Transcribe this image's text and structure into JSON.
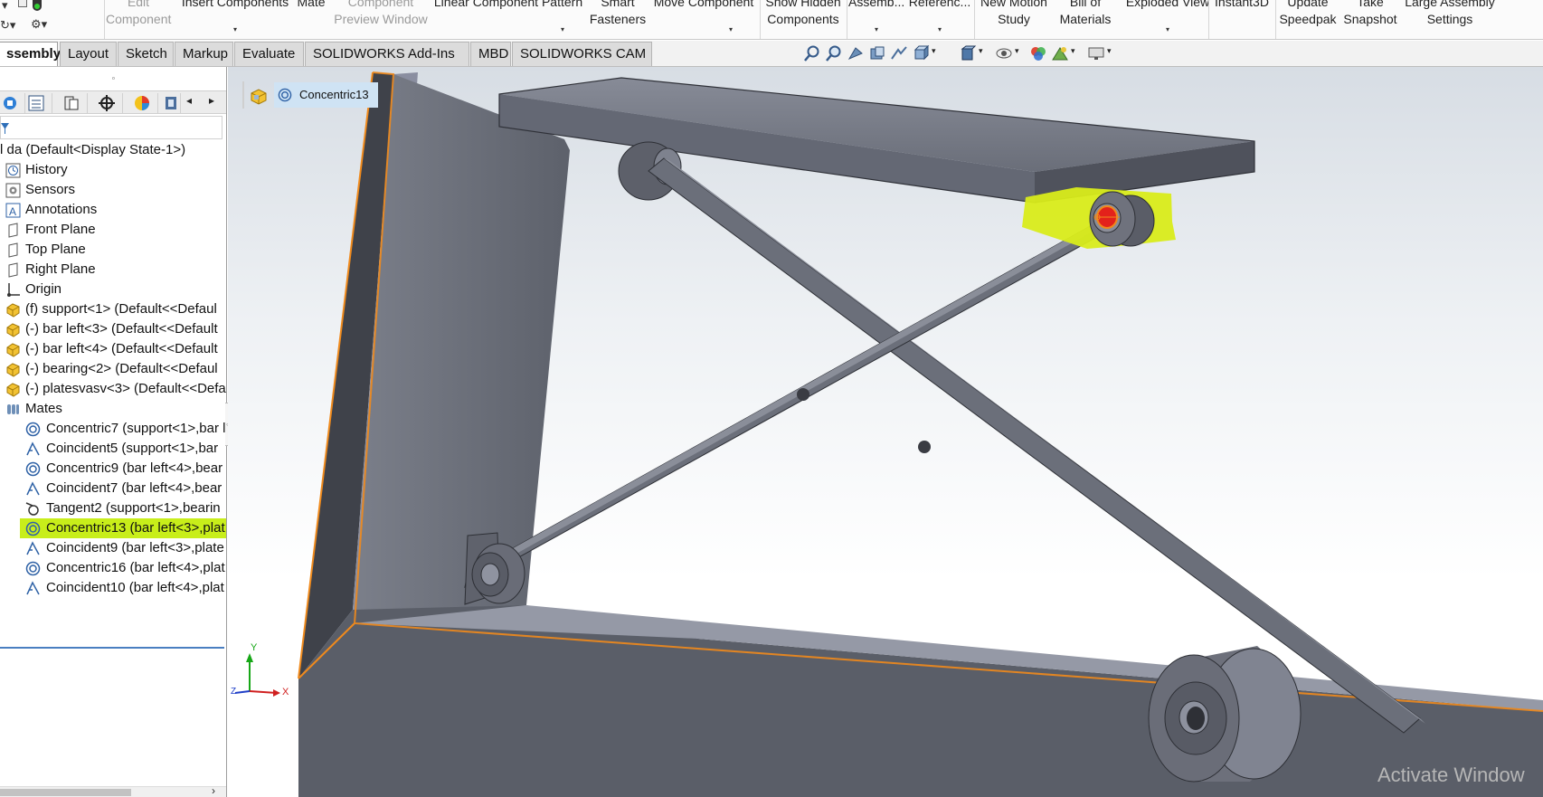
{
  "ribbon": {
    "buttons": [
      {
        "id": "edit-component",
        "lines": [
          "Edit",
          "Component"
        ],
        "disabled": true
      },
      {
        "id": "insert-components",
        "lines": [
          "Insert Components"
        ],
        "dropdown": true
      },
      {
        "id": "mate",
        "lines": [
          "Mate"
        ]
      },
      {
        "id": "component-preview",
        "lines": [
          "Component",
          "Preview Window"
        ],
        "disabled": true
      },
      {
        "id": "linear-pattern",
        "lines": [
          "Linear Component Pattern"
        ],
        "dropdown": true
      },
      {
        "id": "smart-fasteners",
        "lines": [
          "Smart",
          "Fasteners"
        ]
      },
      {
        "id": "move-component",
        "lines": [
          "Move Component"
        ],
        "dropdown": true
      },
      {
        "id": "show-hidden",
        "lines": [
          "Show Hidden",
          "Components"
        ]
      },
      {
        "id": "assembly-features",
        "lines": [
          "Assemb..."
        ],
        "dropdown": true
      },
      {
        "id": "reference-geometry",
        "lines": [
          "Referenc..."
        ],
        "dropdown": true
      },
      {
        "id": "new-motion-study",
        "lines": [
          "New Motion",
          "Study"
        ]
      },
      {
        "id": "bill-of-materials",
        "lines": [
          "Bill of",
          "Materials"
        ]
      },
      {
        "id": "exploded-view",
        "lines": [
          "Exploded View"
        ],
        "dropdown": true
      },
      {
        "id": "instant3d",
        "lines": [
          "Instant3D"
        ]
      },
      {
        "id": "update-speedpak",
        "lines": [
          "Update",
          "Speedpak"
        ]
      },
      {
        "id": "take-snapshot",
        "lines": [
          "Take",
          "Snapshot"
        ]
      },
      {
        "id": "large-assembly",
        "lines": [
          "Large Assembly",
          "Settings"
        ]
      }
    ]
  },
  "tabs": [
    "ssembly",
    "Layout",
    "Sketch",
    "Markup",
    "Evaluate",
    "SOLIDWORKS Add-Ins",
    "MBD",
    "SOLIDWORKS CAM"
  ],
  "active_tab": "ssembly",
  "feature_tree": {
    "root": "l da  (Default<Display State-1>)",
    "items": [
      {
        "label": "History",
        "icon": "history-icon"
      },
      {
        "label": "Sensors",
        "icon": "sensors-icon"
      },
      {
        "label": "Annotations",
        "icon": "annotations-icon"
      },
      {
        "label": "Front Plane",
        "icon": "plane-icon"
      },
      {
        "label": "Top Plane",
        "icon": "plane-icon"
      },
      {
        "label": "Right Plane",
        "icon": "plane-icon"
      },
      {
        "label": "Origin",
        "icon": "origin-icon"
      },
      {
        "label": "(f) support<1> (Default<<Defaul",
        "icon": "part-icon"
      },
      {
        "label": "(-) bar left<3> (Default<<Default",
        "icon": "part-icon"
      },
      {
        "label": "(-) bar left<4> (Default<<Default",
        "icon": "part-icon"
      },
      {
        "label": "(-) bearing<2> (Default<<Defaul",
        "icon": "part-icon"
      },
      {
        "label": "(-) platesvasv<3> (Default<<Defa",
        "icon": "part-icon"
      },
      {
        "label": "Mates",
        "icon": "mates-icon"
      }
    ],
    "mates": [
      {
        "label": "Concentric7 (support<1>,bar l",
        "icon": "concentric-icon"
      },
      {
        "label": "Coincident5 (support<1>,bar",
        "icon": "coincident-icon"
      },
      {
        "label": "Concentric9 (bar left<4>,bear",
        "icon": "concentric-icon"
      },
      {
        "label": "Coincident7 (bar left<4>,bear",
        "icon": "coincident-icon"
      },
      {
        "label": "Tangent2 (support<1>,bearin",
        "icon": "tangent-icon"
      },
      {
        "label": "Concentric13 (bar left<3>,plat",
        "icon": "concentric-icon",
        "selected": true
      },
      {
        "label": "Coincident9 (bar left<3>,plate",
        "icon": "coincident-icon"
      },
      {
        "label": "Concentric16 (bar left<4>,plat",
        "icon": "concentric-icon"
      },
      {
        "label": "Coincident10 (bar left<4>,plat",
        "icon": "coincident-icon"
      }
    ]
  },
  "breadcrumb": {
    "selected": "Concentric13"
  },
  "triad": {
    "x": "X",
    "y": "Y",
    "z": "Z"
  },
  "watermark": "Activate Window",
  "colors": {
    "selection_highlight": "#c8ee1a",
    "mate_face": "#e3221b",
    "edge_highlight": "#f08a1c",
    "part_gray": "#6d717c"
  }
}
